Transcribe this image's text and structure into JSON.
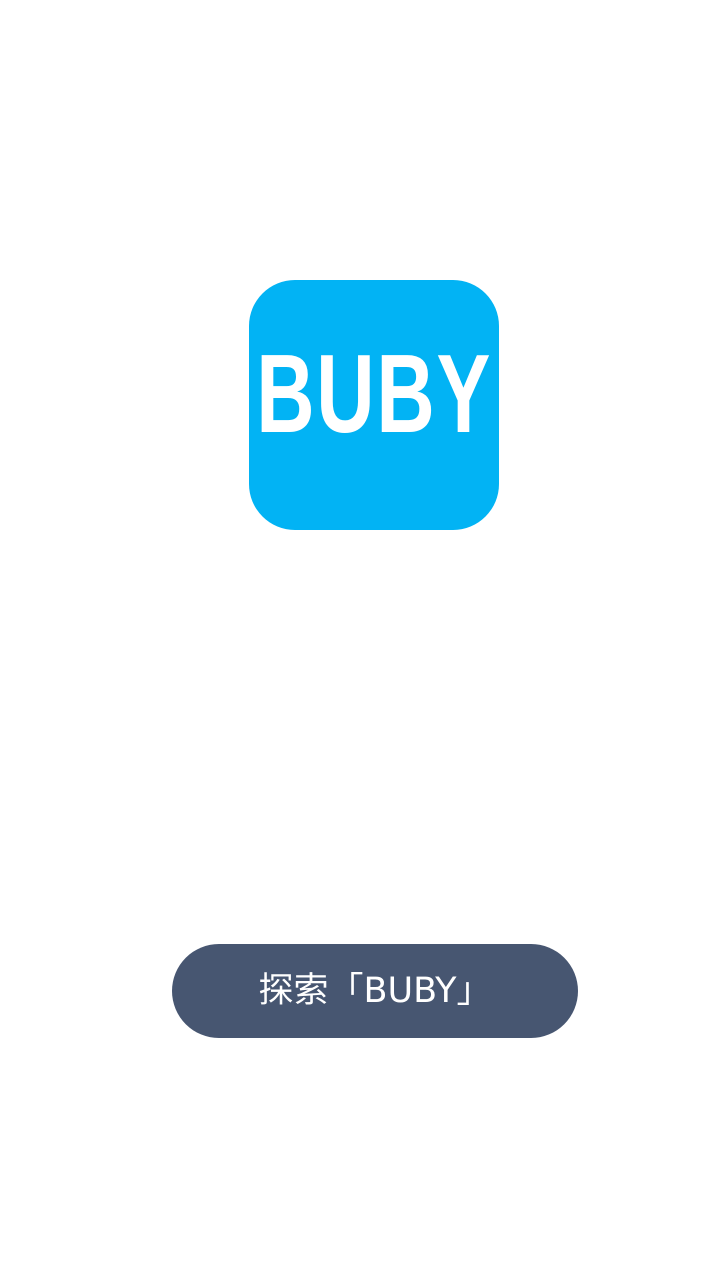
{
  "splash": {
    "logo_text": "BUBY",
    "logo_color": "#02b3f4",
    "background_color": "#ffffff"
  },
  "cta": {
    "label": "探索「BUBY」",
    "button_color": "#475671",
    "text_color": "#ffffff"
  }
}
